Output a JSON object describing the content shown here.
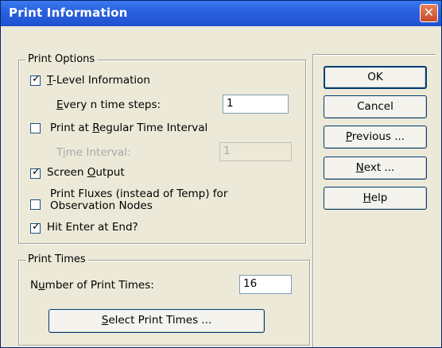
{
  "window": {
    "title": "Print Information",
    "close_symbol": "✕"
  },
  "print_options": {
    "group_label": "Print Options",
    "tlevel": {
      "label_u": "T",
      "label_rest": "-Level Information",
      "checked": true
    },
    "every_n": {
      "label_u": "E",
      "label_rest": "very n time steps:",
      "value": "1"
    },
    "regular": {
      "label_pre": "Print at ",
      "label_u": "R",
      "label_rest": "egular Time Interval",
      "checked": false
    },
    "time_interval": {
      "label_pre": "T",
      "label_u": "i",
      "label_rest": "me Interval:",
      "value": "1"
    },
    "screen": {
      "label_pre": "Screen ",
      "label_u": "O",
      "label_rest": "utput",
      "checked": true
    },
    "fluxes": {
      "line1": "Print Fluxes (instead of Temp) for",
      "line2": "Observation Nodes",
      "checked": false
    },
    "hit_enter": {
      "label": "Hit Enter at End?",
      "checked": true
    }
  },
  "print_times": {
    "group_label": "Print Times",
    "number": {
      "label_pre": "N",
      "label_u": "u",
      "label_rest": "mber of Print Times:",
      "value": "16"
    },
    "select_button": {
      "label_u": "S",
      "label_rest": "elect Print Times ..."
    }
  },
  "buttons": {
    "ok": "OK",
    "cancel": "Cancel",
    "previous": {
      "label_u": "P",
      "label_rest": "revious ..."
    },
    "next": {
      "label_u": "N",
      "label_rest": "ext ..."
    },
    "help": {
      "label_u": "H",
      "label_rest": "elp"
    }
  }
}
